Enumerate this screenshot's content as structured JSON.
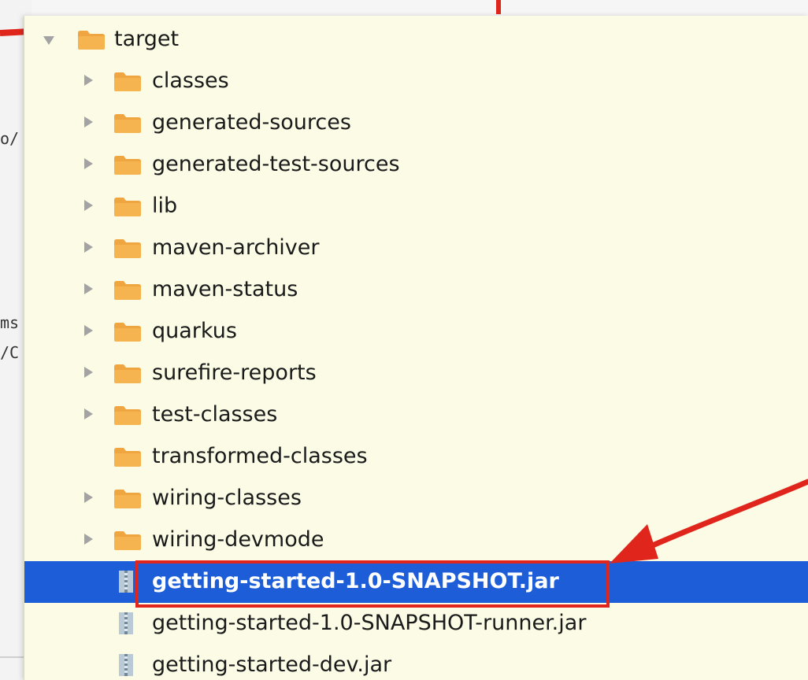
{
  "background": {
    "fragments": [
      "o/",
      "ms",
      "/C"
    ]
  },
  "tree": {
    "root": {
      "label": "target",
      "expanded": true,
      "icon": "folder-icon"
    },
    "folders": [
      {
        "label": "classes",
        "expandable": true
      },
      {
        "label": "generated-sources",
        "expandable": true
      },
      {
        "label": "generated-test-sources",
        "expandable": true
      },
      {
        "label": "lib",
        "expandable": true
      },
      {
        "label": "maven-archiver",
        "expandable": true
      },
      {
        "label": "maven-status",
        "expandable": true
      },
      {
        "label": "quarkus",
        "expandable": true
      },
      {
        "label": "surefire-reports",
        "expandable": true
      },
      {
        "label": "test-classes",
        "expandable": true
      },
      {
        "label": "transformed-classes",
        "expandable": false
      },
      {
        "label": "wiring-classes",
        "expandable": true
      },
      {
        "label": "wiring-devmode",
        "expandable": true
      }
    ],
    "files": [
      {
        "label": "getting-started-1.0-SNAPSHOT.jar",
        "selected": true,
        "icon": "jar-icon"
      },
      {
        "label": "getting-started-1.0-SNAPSHOT-runner.jar",
        "selected": false,
        "icon": "jar-icon"
      },
      {
        "label": "getting-started-dev.jar",
        "selected": false,
        "icon": "jar-icon"
      }
    ]
  },
  "colors": {
    "panel_background": "#fbfbe6",
    "selection": "#1d5ed8",
    "folder": "#f0a640",
    "annotation": "#e0261c"
  }
}
